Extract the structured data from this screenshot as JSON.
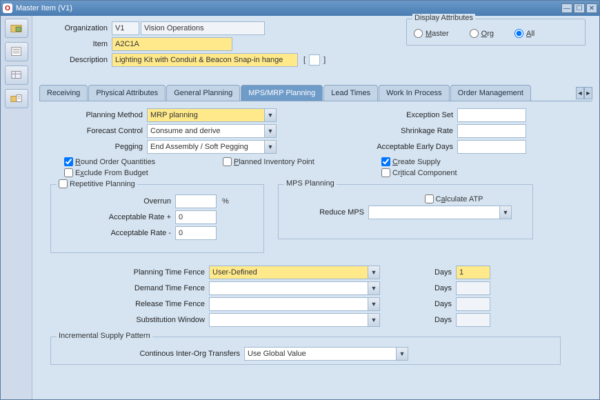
{
  "window": {
    "title": "Master Item (V1)"
  },
  "sidebar": {
    "icons": [
      "folder-cube-icon",
      "list-icon",
      "table-icon",
      "attach-folder-icon"
    ]
  },
  "header": {
    "org_label": "Organization",
    "org_code": "V1",
    "org_name": "Vision Operations",
    "item_label": "Item",
    "item_value": "A2C1A",
    "desc_label": "Description",
    "desc_value": "Lighting Kit with Conduit & Beacon Snap-in hange"
  },
  "display_attrs": {
    "title": "Display Attributes",
    "master": "Master",
    "org": "Org",
    "all": "All",
    "selected": "all"
  },
  "tabs": [
    "Receiving",
    "Physical Attributes",
    "General Planning",
    "MPS/MRP Planning",
    "Lead Times",
    "Work In Process",
    "Order Management"
  ],
  "active_tab": 3,
  "plan": {
    "planning_method_label": "Planning Method",
    "planning_method": "MRP planning",
    "forecast_control_label": "Forecast Control",
    "forecast_control": "Consume and derive",
    "pegging_label": "Pegging",
    "pegging": "End Assembly / Soft Pegging",
    "exception_set_label": "Exception Set",
    "exception_set": "",
    "shrinkage_rate_label": "Shrinkage Rate",
    "shrinkage_rate": "",
    "acceptable_early_days_label": "Acceptable Early Days",
    "acceptable_early_days": "",
    "round_order_qty": "Round Order Quantities",
    "round_order_qty_checked": true,
    "planned_inv_point": "Planned Inventory Point",
    "planned_inv_point_checked": false,
    "create_supply": "Create Supply",
    "create_supply_checked": true,
    "exclude_budget": "Exclude From Budget",
    "exclude_budget_checked": false,
    "critical_component": "Critical Component",
    "critical_component_checked": false
  },
  "repetitive": {
    "title": "Repetitive Planning",
    "checked": false,
    "overrun_label": "Overrun",
    "overrun": "",
    "overrun_unit": "%",
    "rate_plus_label": "Acceptable Rate +",
    "rate_plus": "0",
    "rate_minus_label": "Acceptable Rate -",
    "rate_minus": "0"
  },
  "mps": {
    "title": "MPS Planning",
    "calc_atp": "Calculate ATP",
    "calc_atp_checked": false,
    "reduce_mps_label": "Reduce MPS",
    "reduce_mps": ""
  },
  "fences": {
    "planning_tf_label": "Planning Time Fence",
    "planning_tf": "User-Defined",
    "demand_tf_label": "Demand Time Fence",
    "demand_tf": "",
    "release_tf_label": "Release Time Fence",
    "release_tf": "",
    "subst_win_label": "Substitution Window",
    "subst_win": "",
    "days_label": "Days",
    "planning_days": "1",
    "demand_days": "",
    "release_days": "",
    "subst_days": ""
  },
  "incremental": {
    "title": "Incremental Supply Pattern",
    "cont_label": "Continous Inter-Org Transfers",
    "cont_value": "Use Global Value"
  }
}
